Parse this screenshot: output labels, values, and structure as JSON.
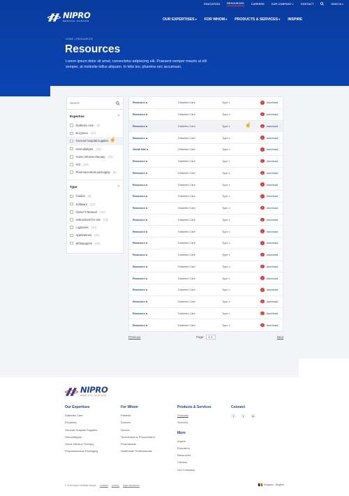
{
  "brand": {
    "name": "NIPRO",
    "tagline": "MEDICAL EUROPE"
  },
  "topbar": {
    "items": [
      "EDUCATION",
      "RESOURCES",
      "CAREERS",
      "OUR COMPANY",
      "CONTACT"
    ],
    "search_icon": "search-icon",
    "signin": "SIGN IN"
  },
  "mainnav": {
    "items": [
      "OUR EXPERTISES",
      "FOR WHOM",
      "PRODUCTS & SERVICES",
      "INSPIRE"
    ]
  },
  "breadcrumb": {
    "home": "HOME",
    "sep": "|",
    "current": "RESOURCES"
  },
  "page": {
    "title": "Resources",
    "intro": "Lorem ipsum dolor sit amet, consectetur adipiscing elit. Praesent semper mauris ut elit semper, at molestie tellus aliquam. In felis leo, pharetra nec accumsan."
  },
  "sidebar": {
    "search_placeholder": "Search",
    "groups": [
      {
        "title": "Expertise",
        "items": [
          {
            "label": "Diabetes care",
            "count": "(5)"
          },
          {
            "label": "Enzymes",
            "count": "(12)"
          },
          {
            "label": "General hospital supplies",
            "count": ""
          },
          {
            "label": "Hemodialysis",
            "count": "(15)"
          },
          {
            "label": "Home infusion therapy",
            "count": "(10)"
          },
          {
            "label": "IVD",
            "count": "(10)"
          },
          {
            "label": "Pharmaceutical packaging",
            "count": "(5)"
          }
        ]
      },
      {
        "title": "Type",
        "items": [
          {
            "label": "Guides",
            "count": "(8)"
          },
          {
            "label": "Software",
            "count": "(12)"
          },
          {
            "label": "Owner's Manual",
            "count": "(10)"
          },
          {
            "label": "Instructions for use",
            "count": "(16)"
          },
          {
            "label": "Logbooks",
            "count": "(10)"
          },
          {
            "label": "Applications",
            "count": "(20)"
          },
          {
            "label": "Whitepapers",
            "count": "(15)"
          }
        ]
      }
    ]
  },
  "table": {
    "download_label": "download",
    "rows": [
      {
        "name": "Resource a",
        "category": "Diabetes Care",
        "type": "Type x"
      },
      {
        "name": "Resource a",
        "category": "Diabetes Care",
        "type": "Type x"
      },
      {
        "name": "Resource a",
        "category": "Diabetes Care",
        "type": "Type x"
      },
      {
        "name": "Resource a",
        "category": "Diabetes Care",
        "type": "Type x"
      },
      {
        "name": "Guide title a",
        "category": "Diabetes Care",
        "type": "Type x"
      },
      {
        "name": "Resource a",
        "category": "Diabetes Care",
        "type": "Type x"
      },
      {
        "name": "Resource a",
        "category": "Diabetes Care",
        "type": "Type x"
      },
      {
        "name": "Resource a",
        "category": "Diabetes Care",
        "type": "Type x"
      },
      {
        "name": "Resource a",
        "category": "Diabetes Care",
        "type": "Type x"
      },
      {
        "name": "Resource a",
        "category": "Diabetes Care",
        "type": "Type x"
      },
      {
        "name": "Resource a",
        "category": "Diabetes Care",
        "type": "Type x"
      },
      {
        "name": "Resource a",
        "category": "Diabetes Care",
        "type": "Type x"
      },
      {
        "name": "Resource a",
        "category": "Diabetes Care",
        "type": "Type x"
      },
      {
        "name": "Resource a",
        "category": "Diabetes Care",
        "type": "Type x"
      },
      {
        "name": "Resource a",
        "category": "Diabetes Care",
        "type": "Type x"
      },
      {
        "name": "Resource a",
        "category": "Diabetes Care",
        "type": "Type x"
      },
      {
        "name": "Resource a",
        "category": "Diabetes Care",
        "type": "Type x"
      },
      {
        "name": "Resource a",
        "category": "Diabetes Care",
        "type": "Type x"
      },
      {
        "name": "Resource a",
        "category": "Diabetes Care",
        "type": "Type x"
      },
      {
        "name": "Resource a",
        "category": "Diabetes Care",
        "type": "Type x"
      }
    ]
  },
  "pager": {
    "prev": "Previous",
    "page_label": "Page",
    "page_value": "1",
    "next": "Next"
  },
  "footer": {
    "columns": [
      {
        "title": "Our Expertises",
        "items": [
          "Diabetes Care",
          "Enzymes",
          "General Hospital Supplies",
          "Hemodialysis",
          "Home Infusion Therapy",
          "Pharmaceutical Packaging"
        ]
      },
      {
        "title": "For Whom",
        "items": [
          "Patients",
          "Doctors",
          "Nurses",
          "Technicians & Procurement",
          "Pharmacists",
          "Healthcare Professionals"
        ]
      },
      {
        "title": "Products & Services",
        "items": [
          "Products",
          "Services"
        ]
      },
      {
        "title": "More",
        "items": [
          "Inspire",
          "Education",
          "Resources",
          "Careers",
          "Our Company"
        ]
      },
      {
        "title": "Connect",
        "items": [
          "f",
          "t",
          "in"
        ]
      }
    ],
    "copyright": "© 2019 nipro medical europe",
    "legal": [
      "cookies",
      "privacy",
      "legal disclaimer"
    ],
    "language": "Belgium - English"
  },
  "colors": {
    "brand_blue": "#0a44b4",
    "accent_red": "#e53935",
    "link_blue": "#1d3f9a"
  }
}
